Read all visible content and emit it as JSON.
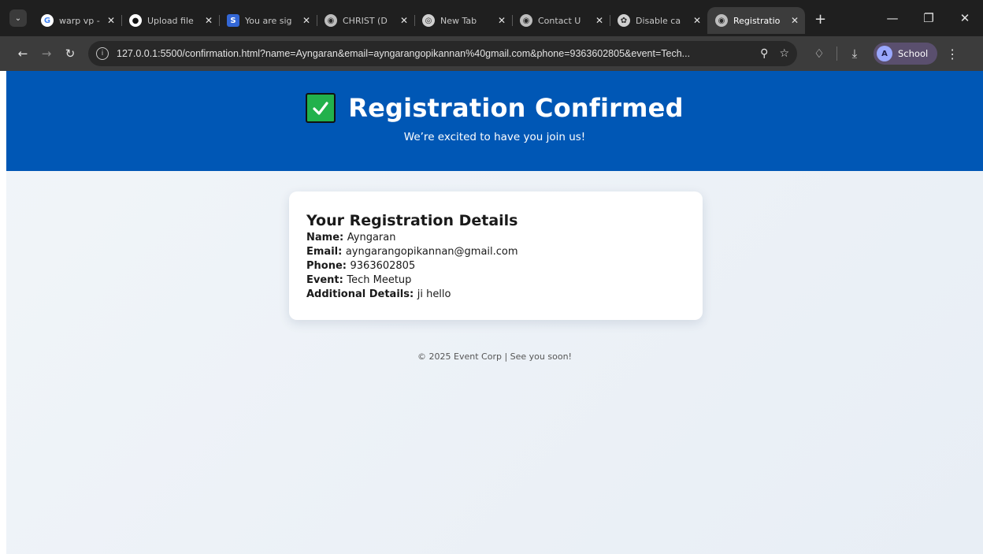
{
  "tabs": [
    {
      "title": "warp vp - (",
      "favicon": "google-icon",
      "active": false
    },
    {
      "title": "Upload file",
      "favicon": "github-icon",
      "active": false
    },
    {
      "title": "You are sig",
      "favicon": "s-icon",
      "active": false
    },
    {
      "title": "CHRIST (D",
      "favicon": "globe-icon",
      "active": false
    },
    {
      "title": "New Tab",
      "favicon": "chrome-icon",
      "active": false
    },
    {
      "title": "Contact U",
      "favicon": "globe-icon",
      "active": false
    },
    {
      "title": "Disable ca",
      "favicon": "chatgpt-icon",
      "active": false
    },
    {
      "title": "Registratio",
      "favicon": "globe-icon",
      "active": true
    }
  ],
  "toolbar": {
    "url": "127.0.0.1:5500/confirmation.html?name=Ayngaran&email=ayngarangopikannan%40gmail.com&phone=9363602805&event=Tech...",
    "profile_initial": "A",
    "profile_name": "School"
  },
  "hero": {
    "title": "Registration Confirmed",
    "subtitle": "We’re excited to have you join us!"
  },
  "card": {
    "heading": "Your Registration Details",
    "fields": [
      {
        "label": "Name:",
        "value": "Ayngaran"
      },
      {
        "label": "Email:",
        "value": "ayngarangopikannan@gmail.com"
      },
      {
        "label": "Phone:",
        "value": "9363602805"
      },
      {
        "label": "Event:",
        "value": "Tech Meetup"
      },
      {
        "label": "Additional Details:",
        "value": "ji hello"
      }
    ]
  },
  "footer": {
    "text": "© 2025 Event Corp | See you soon!"
  },
  "colors": {
    "header_blue": "#0057b5",
    "check_green": "#22b14c"
  }
}
